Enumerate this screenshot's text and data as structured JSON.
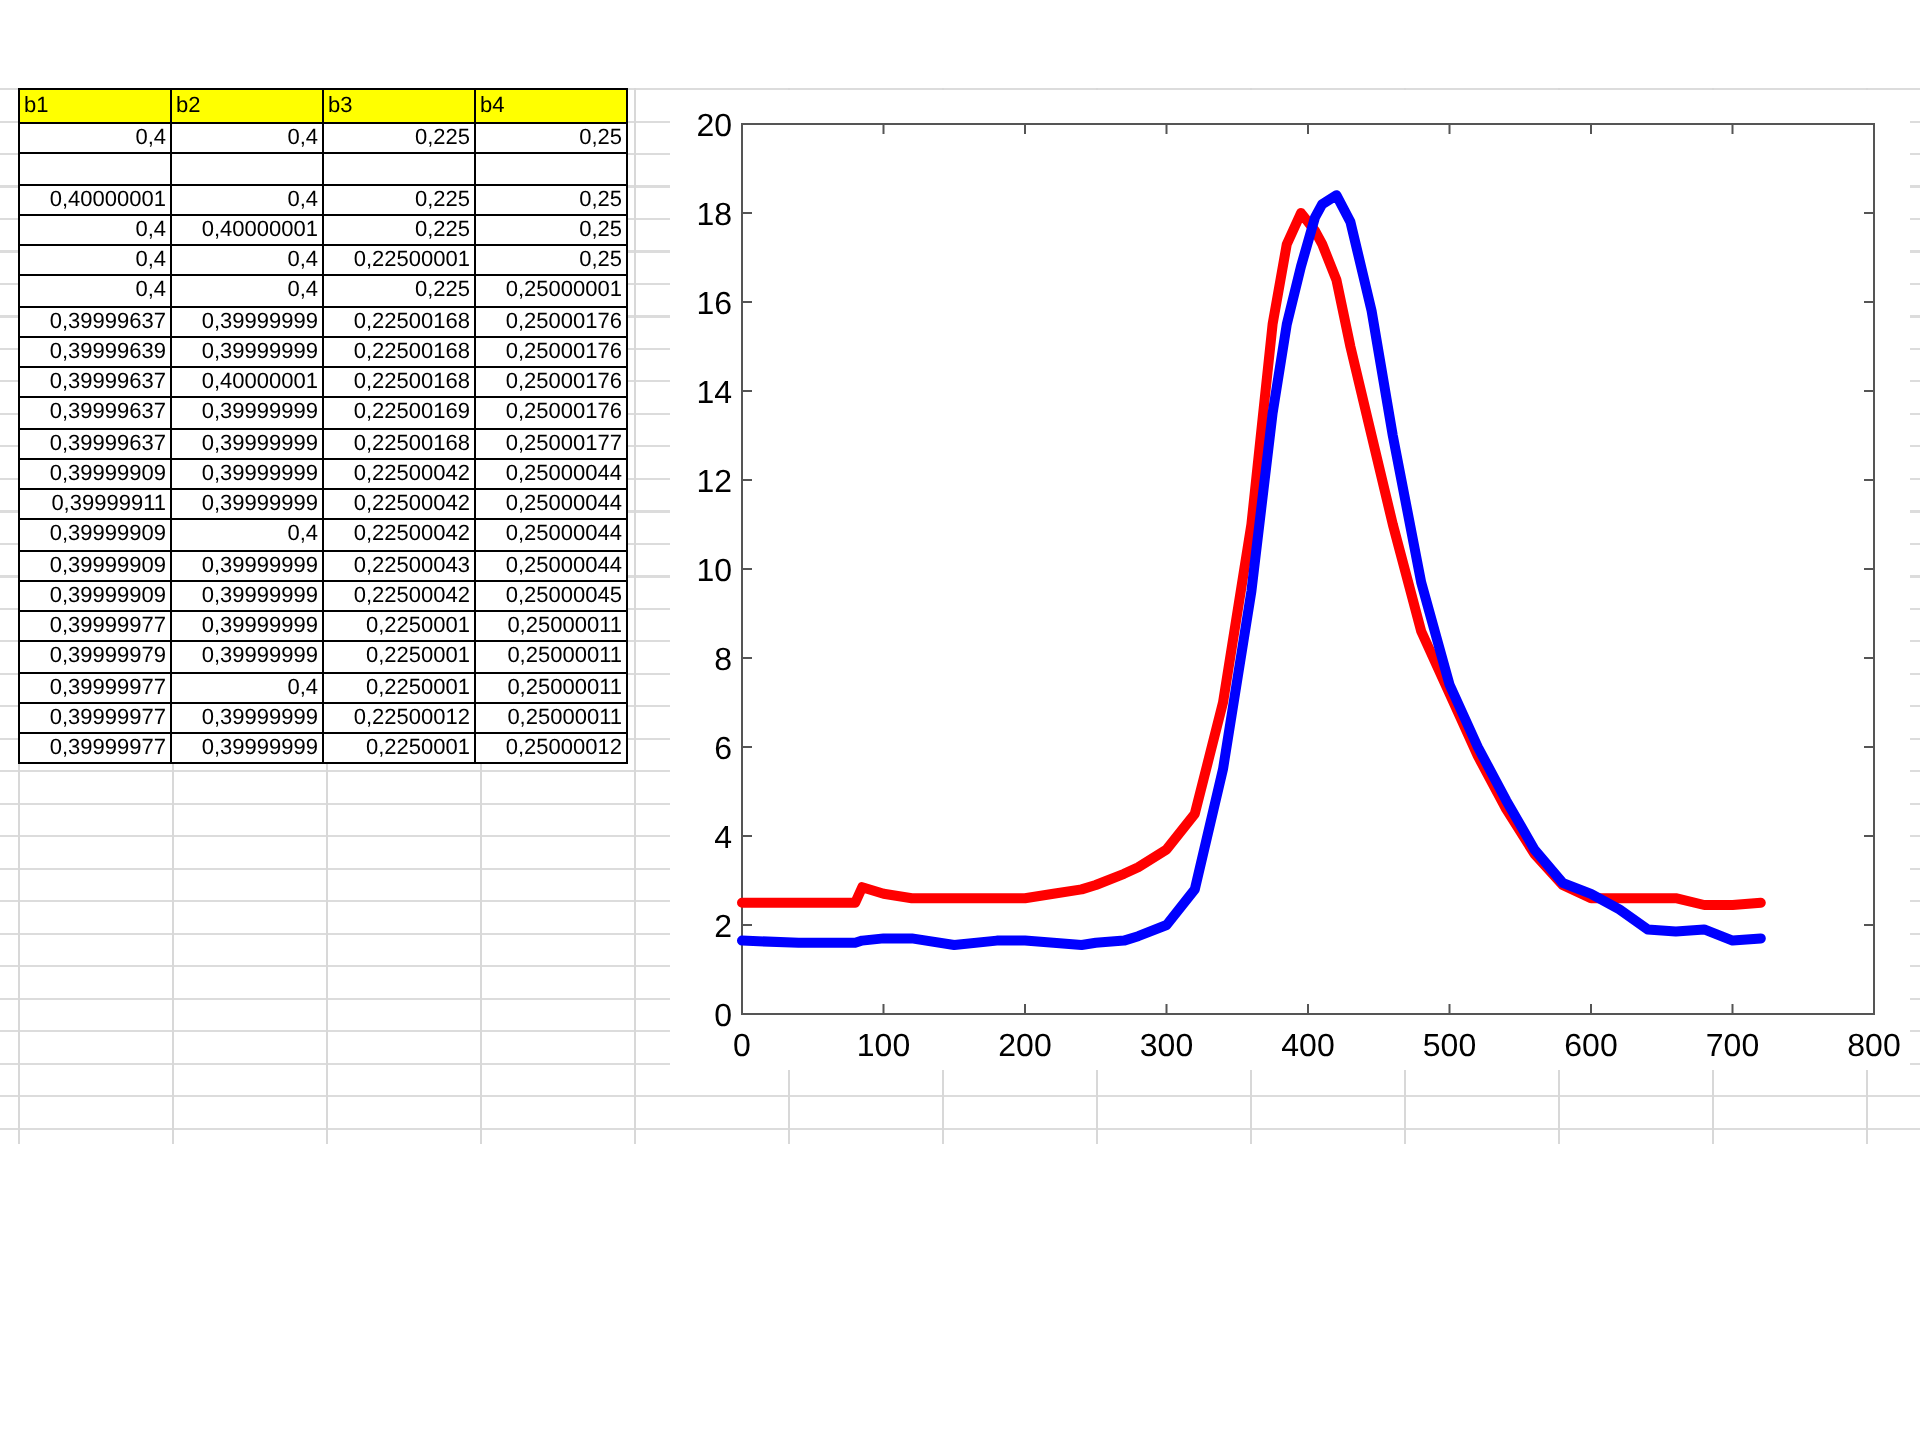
{
  "table": {
    "columns": [
      "b1",
      "b2",
      "b3",
      "b4"
    ],
    "rows": [
      {
        "kind": "values",
        "cells": [
          "0,4",
          "0,4",
          "0,225",
          "0,25"
        ]
      },
      {
        "kind": "blank"
      },
      {
        "kind": "values",
        "cells": [
          "0,40000001",
          "0,4",
          "0,225",
          "0,25"
        ]
      },
      {
        "kind": "values",
        "cells": [
          "0,4",
          "0,40000001",
          "0,225",
          "0,25"
        ]
      },
      {
        "kind": "values",
        "cells": [
          "0,4",
          "0,4",
          "0,22500001",
          "0,25"
        ]
      },
      {
        "kind": "values",
        "cells": [
          "0,4",
          "0,4",
          "0,225",
          "0,25000001"
        ]
      },
      {
        "kind": "values",
        "cells": [
          "0,39999637",
          "0,39999999",
          "0,22500168",
          "0,25000176"
        ]
      },
      {
        "kind": "values",
        "cells": [
          "0,39999639",
          "0,39999999",
          "0,22500168",
          "0,25000176"
        ]
      },
      {
        "kind": "values",
        "cells": [
          "0,39999637",
          "0,40000001",
          "0,22500168",
          "0,25000176"
        ]
      },
      {
        "kind": "values",
        "cells": [
          "0,39999637",
          "0,39999999",
          "0,22500169",
          "0,25000176"
        ]
      },
      {
        "kind": "values",
        "cells": [
          "0,39999637",
          "0,39999999",
          "0,22500168",
          "0,25000177"
        ]
      },
      {
        "kind": "values",
        "cells": [
          "0,39999909",
          "0,39999999",
          "0,22500042",
          "0,25000044"
        ]
      },
      {
        "kind": "values",
        "cells": [
          "0,39999911",
          "0,39999999",
          "0,22500042",
          "0,25000044"
        ]
      },
      {
        "kind": "values",
        "cells": [
          "0,39999909",
          "0,4",
          "0,22500042",
          "0,25000044"
        ]
      },
      {
        "kind": "values",
        "cells": [
          "0,39999909",
          "0,39999999",
          "0,22500043",
          "0,25000044"
        ]
      },
      {
        "kind": "values",
        "cells": [
          "0,39999909",
          "0,39999999",
          "0,22500042",
          "0,25000045"
        ]
      },
      {
        "kind": "values",
        "cells": [
          "0,39999977",
          "0,39999999",
          "0,2250001",
          "0,25000011"
        ]
      },
      {
        "kind": "values",
        "cells": [
          "0,39999979",
          "0,39999999",
          "0,2250001",
          "0,25000011"
        ]
      },
      {
        "kind": "values",
        "cells": [
          "0,39999977",
          "0,4",
          "0,2250001",
          "0,25000011"
        ]
      },
      {
        "kind": "values",
        "cells": [
          "0,39999977",
          "0,39999999",
          "0,22500012",
          "0,25000011"
        ]
      },
      {
        "kind": "values",
        "cells": [
          "0,39999977",
          "0,39999999",
          "0,2250001",
          "0,25000012"
        ]
      }
    ]
  },
  "chart": {
    "chart_data": {
      "type": "line",
      "x": [
        0,
        40,
        80,
        85,
        100,
        120,
        150,
        180,
        200,
        220,
        240,
        250,
        270,
        280,
        300,
        320,
        340,
        360,
        375,
        385,
        395,
        405,
        410,
        420,
        430,
        445,
        460,
        480,
        500,
        520,
        540,
        560,
        580,
        600,
        620,
        640,
        660,
        680,
        700,
        720
      ],
      "series": [
        {
          "color": "#ff0000",
          "values": [
            2.5,
            2.5,
            2.5,
            2.85,
            2.7,
            2.6,
            2.6,
            2.6,
            2.6,
            2.7,
            2.8,
            2.9,
            3.15,
            3.3,
            3.7,
            4.5,
            7,
            11,
            15.5,
            17.3,
            18,
            17.6,
            17.3,
            16.5,
            15,
            13,
            11,
            8.6,
            7.2,
            5.8,
            4.6,
            3.6,
            2.9,
            2.6,
            2.6,
            2.6,
            2.6,
            2.45,
            2.45,
            2.5
          ]
        },
        {
          "color": "#0000ff",
          "values": [
            1.65,
            1.6,
            1.6,
            1.65,
            1.7,
            1.7,
            1.55,
            1.65,
            1.65,
            1.6,
            1.55,
            1.6,
            1.65,
            1.75,
            2.0,
            2.8,
            5.5,
            9.5,
            13.5,
            15.5,
            16.8,
            17.9,
            18.2,
            18.4,
            17.8,
            15.8,
            13,
            9.7,
            7.4,
            6,
            4.8,
            3.7,
            2.95,
            2.7,
            2.35,
            1.9,
            1.85,
            1.9,
            1.65,
            1.7
          ]
        }
      ],
      "xlim": [
        0,
        800
      ],
      "ylim": [
        0,
        20
      ],
      "xticks": [
        0,
        100,
        200,
        300,
        400,
        500,
        600,
        700,
        800
      ],
      "yticks": [
        0,
        2,
        4,
        6,
        8,
        10,
        12,
        14,
        16,
        18,
        20
      ]
    }
  }
}
